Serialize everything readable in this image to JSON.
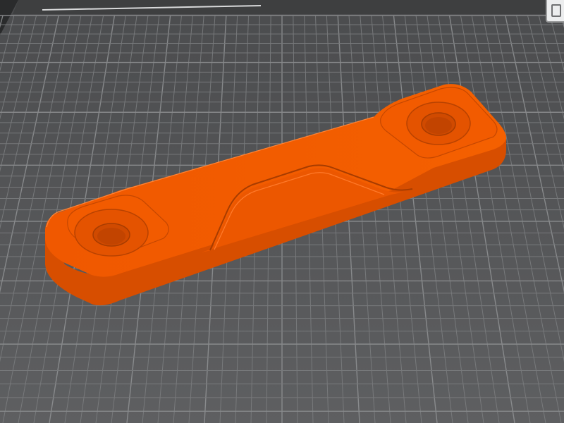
{
  "app": {
    "view": "3d-viewport",
    "bed_label": ""
  },
  "scene": {
    "model": "bracket-plate",
    "icons": [
      "corner-marker-icon",
      "build-plate",
      "bracket-model"
    ]
  },
  "colors": {
    "bed": "#5a5b5d",
    "grid": "#787a7c",
    "grid_major": "#8a8c8e",
    "bed_edge": "#3a3b3c",
    "background": "#2a2b2c",
    "model_top": "#f25a00",
    "model_side": "#d94f00",
    "model_dark": "#b84200",
    "model_highlight": "#ff7a2a"
  }
}
